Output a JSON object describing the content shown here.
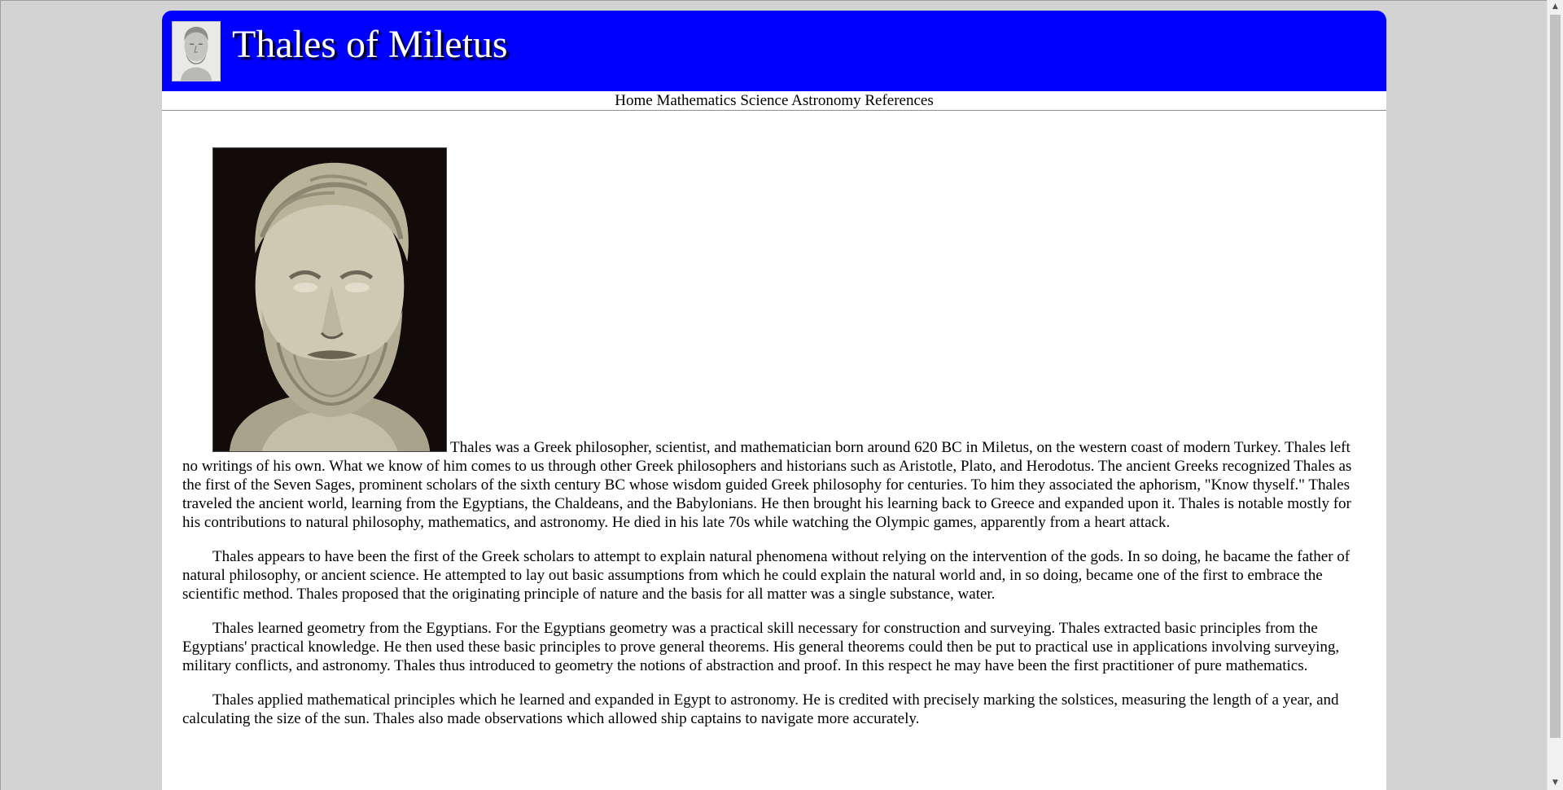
{
  "header": {
    "title": "Thales of Miletus",
    "logo_icon": "thales-bust-thumbnail",
    "background_color": "#0000ff"
  },
  "nav": {
    "items": [
      {
        "label": "Home"
      },
      {
        "label": "Mathematics"
      },
      {
        "label": "Science"
      },
      {
        "label": "Astronomy"
      },
      {
        "label": "References"
      }
    ]
  },
  "content": {
    "portrait_icon": "thales-bust-portrait",
    "paragraphs": [
      "Thales was a Greek philosopher, scientist, and mathematician born around 620 BC in Miletus, on the western coast of modern Turkey. Thales left no writings of his own. What we know of him comes to us through other Greek philosophers and historians such as Aristotle, Plato, and Herodotus. The ancient Greeks recognized Thales as the first of the Seven Sages, prominent scholars of the sixth century BC whose wisdom guided Greek philosophy for centuries. To him they associated the aphorism, \"Know thyself.\" Thales traveled the ancient world, learning from the Egyptians, the Chaldeans, and the Babylonians. He then brought his learning back to Greece and expanded upon it. Thales is notable mostly for his contributions to natural philosophy, mathematics, and astronomy. He died in his late 70s while watching the Olympic games, apparently from a heart attack.",
      "Thales appears to have been the first of the Greek scholars to attempt to explain natural phenomena without relying on the intervention of the gods. In so doing, he bacame the father of natural philosophy, or ancient science. He attempted to lay out basic assumptions from which he could explain the natural world and, in so doing, became one of the first to embrace the scientific method. Thales proposed that the originating principle of nature and the basis for all matter was a single substance, water.",
      "Thales learned geometry from the Egyptians. For the Egyptians geometry was a practical skill necessary for construction and surveying. Thales extracted basic principles from the Egyptians' practical knowledge. He then used these basic principles to prove general theorems. His general theorems could then be put to practical use in applications involving surveying, military conflicts, and astronomy. Thales thus introduced to geometry the notions of abstraction and proof. In this respect he may have been the first practitioner of pure mathematics.",
      "Thales applied mathematical principles which he learned and expanded in Egypt to astronomy. He is credited with precisely marking the solstices, measuring the length of a year, and calculating the size of the sun. Thales also made observations which allowed ship captains to navigate more accurately."
    ]
  },
  "scrollbar": {
    "up_icon": "scroll-up-arrow-icon",
    "down_icon": "scroll-down-arrow-icon"
  }
}
